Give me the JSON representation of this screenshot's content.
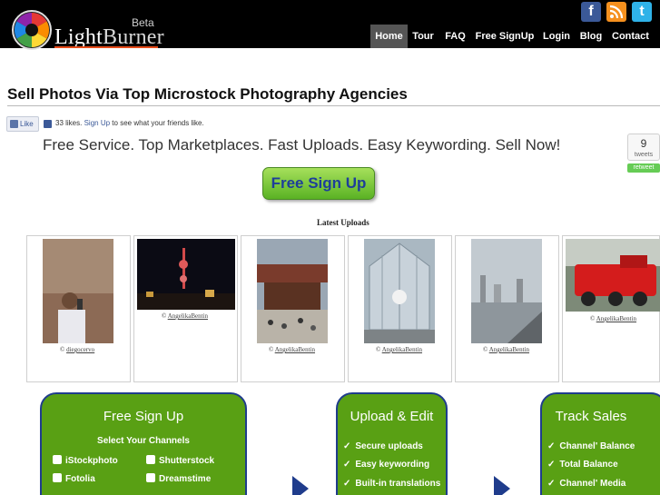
{
  "header": {
    "brand_part1": "Light",
    "brand_part2": "Burner",
    "beta": "Beta",
    "social": [
      "facebook-icon",
      "rss-icon",
      "twitter-icon"
    ],
    "nav": [
      "Home",
      "Tour",
      "FAQ",
      "Free SignUp",
      "Login",
      "Blog",
      "Contact"
    ],
    "active_nav": "Home"
  },
  "page": {
    "title": "Sell Photos Via Top Microstock Photography Agencies",
    "tagline": "Free Service. Top Marketplaces. Fast Uploads. Easy Keywording. Sell Now!",
    "signup_button": "Free Sign Up",
    "latest_heading": "Latest Uploads"
  },
  "like": {
    "button": "Like",
    "count_text": "33 likes.",
    "signup_link": "Sign Up",
    "suffix": "to see what your friends like."
  },
  "tweet": {
    "count": "9",
    "label": "tweets",
    "retweet": "retweet"
  },
  "uploads": [
    {
      "author": "diegocervo",
      "photo": "man-phone"
    },
    {
      "author": "AngelikaBentin",
      "photo": "tower-night"
    },
    {
      "author": "AngelikaBentin",
      "photo": "temple-crowd"
    },
    {
      "author": "AngelikaBentin",
      "photo": "glass-apple"
    },
    {
      "author": "AngelikaBentin",
      "photo": "river-city"
    },
    {
      "author": "AngelikaBentin",
      "photo": "red-train"
    }
  ],
  "panels": {
    "signup": {
      "title": "Free Sign Up",
      "subtitle": "Select Your Channels",
      "channels": [
        "iStockphoto",
        "Shutterstock",
        "Fotolia",
        "Dreamstime"
      ]
    },
    "upload": {
      "title": "Upload & Edit",
      "features": [
        "Secure uploads",
        "Easy keywording",
        "Built-in translations"
      ]
    },
    "track": {
      "title": "Track Sales",
      "features": [
        "Channel' Balance",
        "Total Balance",
        "Channel' Media"
      ]
    }
  },
  "colors": {
    "accent_green": "#59a014",
    "panel_border": "#1f3c8c",
    "header_bg": "#000000"
  }
}
